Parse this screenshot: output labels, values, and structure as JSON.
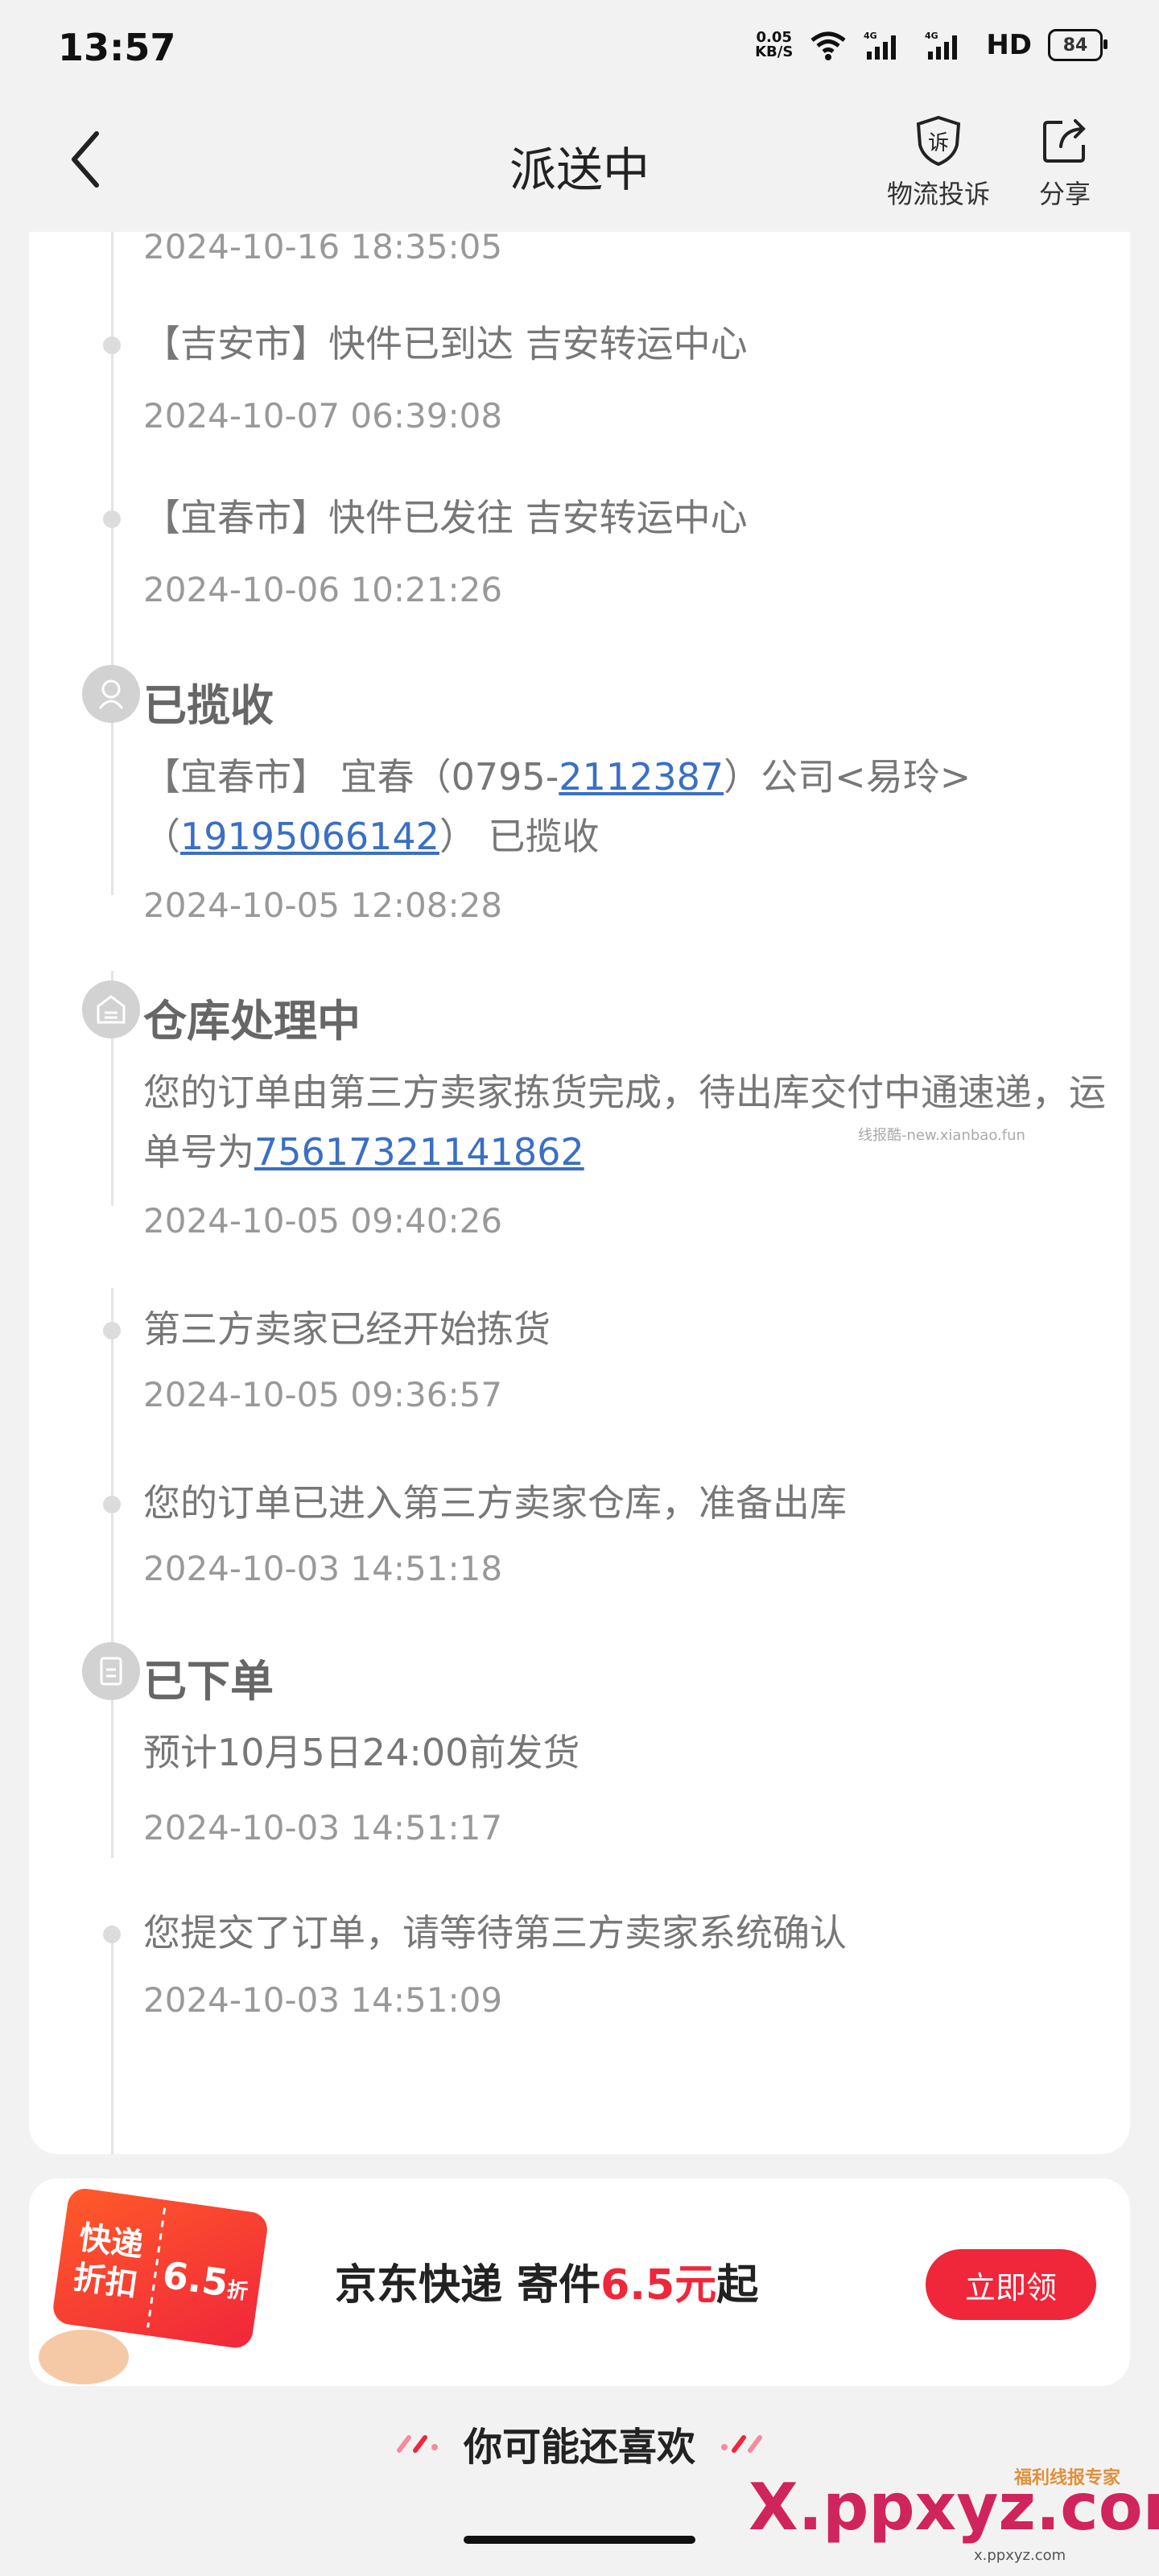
{
  "status_bar": {
    "time": "13:57",
    "net_speed_value": "0.05",
    "net_speed_unit": "KB/S",
    "hd": "HD",
    "battery": "84"
  },
  "nav": {
    "title": "派送中",
    "complain_label": "物流投诉",
    "share_label": "分享",
    "complain_badge": "诉"
  },
  "timeline": {
    "top_time": "2024-10-16 18:35:05",
    "e1_desc": "【吉安市】快件已到达 吉安转运中心",
    "e1_time": "2024-10-07 06:39:08",
    "e2_desc": "【宜春市】快件已发往 吉安转运中心",
    "e2_time": "2024-10-06 10:21:26",
    "s1_title": "已揽收",
    "s1_desc_a": "【宜春市】 宜春（0795-",
    "s1_phone1": "2112387",
    "s1_desc_b": "）公司<易玲>",
    "s1_desc_c": "（",
    "s1_phone2": "19195066142",
    "s1_desc_d": "） 已揽收",
    "s1_time": "2024-10-05 12:08:28",
    "s2_title": "仓库处理中",
    "s2_desc_a": "您的订单由第三方卖家拣货完成，待出库交付中通速递，运单号为",
    "s2_waybill": "75617321141862",
    "s2_time": "2024-10-05 09:40:26",
    "e3_desc": "第三方卖家已经开始拣货",
    "e3_time": "2024-10-05 09:36:57",
    "e4_desc": "您的订单已进入第三方卖家仓库，准备出库",
    "e4_time": "2024-10-03 14:51:18",
    "s3_title": "已下单",
    "s3_desc": "预计10月5日24:00前发货",
    "s3_time": "2024-10-03 14:51:17",
    "e5_desc": "您提交了订单，请等待第三方卖家系统确认",
    "e5_time": "2024-10-03 14:51:09",
    "watermark": "线报酷-new.xianbao.fun"
  },
  "promo": {
    "coupon_line1": "快递",
    "coupon_line2": "折扣",
    "coupon_value": "6.5",
    "coupon_unit": "折",
    "text_a": "京东快递 寄件",
    "text_price": "6.5元",
    "text_b": "起",
    "button": "立即领"
  },
  "recommend": {
    "title": "你可能还喜欢"
  },
  "brand": {
    "mark": "X.ppxyz.com",
    "sub": "x.ppxyz.com",
    "top": "福利线报专家"
  },
  "colors": {
    "accent_red": "#f0263a",
    "link_blue": "#3a6fc4",
    "bg": "#f2f2f2"
  }
}
